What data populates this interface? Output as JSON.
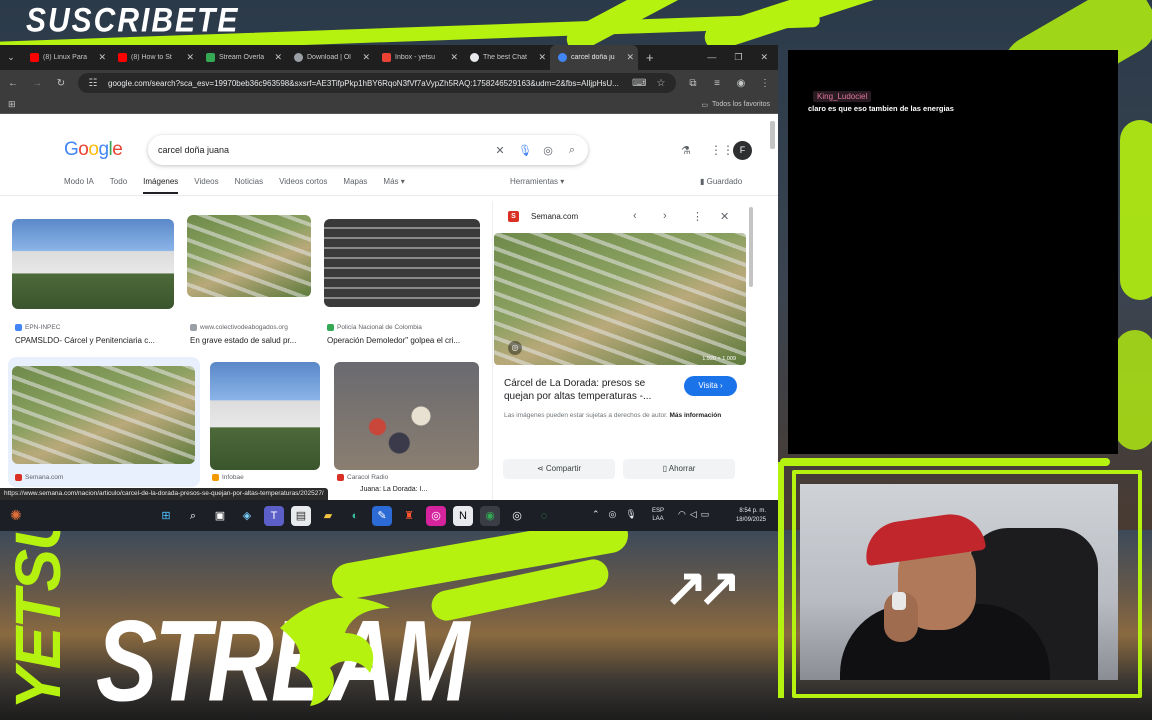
{
  "overlay": {
    "subscribe_text": "SUSCRIBETE",
    "brand_vertical": "YETSUS",
    "brand_main": "STREAM",
    "arrows": "↗↗",
    "accent_color": "#b5f20f"
  },
  "chat": {
    "username": "King_Ludociel",
    "message": "claro es que eso tambien de las energias"
  },
  "browser": {
    "tabs": [
      {
        "label": "(8) Linux Para",
        "favicon_color": "#ff0000",
        "icon": "youtube-icon"
      },
      {
        "label": "(8) How to St",
        "favicon_color": "#ff0000",
        "icon": "youtube-icon"
      },
      {
        "label": "Stream Overla",
        "favicon_color": "#34a853",
        "icon": "stream-icon"
      },
      {
        "label": "Download | Ol",
        "favicon_color": "#9aa0a6",
        "icon": "download-icon"
      },
      {
        "label": "Inbox - yetsu",
        "favicon_color": "#ea4335",
        "icon": "gmail-icon"
      },
      {
        "label": "The best Chat",
        "favicon_color": "#e8eaed",
        "icon": "chatgpt-icon"
      },
      {
        "label": "carcel doña ju",
        "favicon_color": "#4285f4",
        "icon": "google-icon"
      }
    ],
    "url": "google.com/search?sca_esv=19970beb36c963598&sxsrf=AE3TifpPkp1hBY6RqoN3fVf7aVypZh5RAQ:1758246529163&udm=2&fbs=AIljpHsU...",
    "bookmarks_all": "Todos los favoritos"
  },
  "google": {
    "logo": [
      "G",
      "o",
      "o",
      "g",
      "l",
      "e"
    ],
    "query": "carcel doña juana",
    "avatar_letter": "F",
    "tabs": [
      "Modo IA",
      "Todo",
      "Imágenes",
      "Videos",
      "Noticias",
      "Videos cortos",
      "Mapas",
      "Más ▾"
    ],
    "active_tab": "Imágenes",
    "tools_label": "Herramientas ▾",
    "saved_label": "Guardado",
    "results": [
      {
        "source": "EPN-INPEC",
        "title": "CPAMSLDO- Cárcel y Penitenciaria c...",
        "source_color": "#4285f4"
      },
      {
        "source": "www.colectivodeabogados.org",
        "title": "En grave estado de salud pr...",
        "source_color": "#9aa0a6"
      },
      {
        "source": "Policía Nacional de Colombia",
        "title": "Operación Demoledor\" golpea el cri...",
        "source_color": "#34a853"
      },
      {
        "source": "Semana.com",
        "title": "",
        "source_color": "#d93025"
      },
      {
        "source": "Infobae",
        "title": "",
        "source_color": "#f29900"
      },
      {
        "source": "Caracol Radio",
        "title": "Juana: La Dorada: I...",
        "source_color": "#d93025"
      }
    ],
    "preview": {
      "site": "Semana.com",
      "favicon_letter": "S",
      "dimensions": "1.920 × 1.009",
      "title": "Cárcel de La Dorada: presos se quejan por altas temperaturas -...",
      "visit_label": "Visita ›",
      "rights_text": "Las imágenes pueden estar sujetas a derechos de autor.",
      "more_info": "Más información",
      "share_label": "Compartir",
      "save_label": "Ahorrar"
    },
    "status_url": "https://www.semana.com/nacion/articulo/carcel-de-la-dorada-presos-se-quejan-por-altas-temperaturas/202527/"
  },
  "taskbar": {
    "lang_top": "ESP",
    "lang_bottom": "LAA",
    "time": "8:54 p. m.",
    "date": "18/09/2025"
  }
}
